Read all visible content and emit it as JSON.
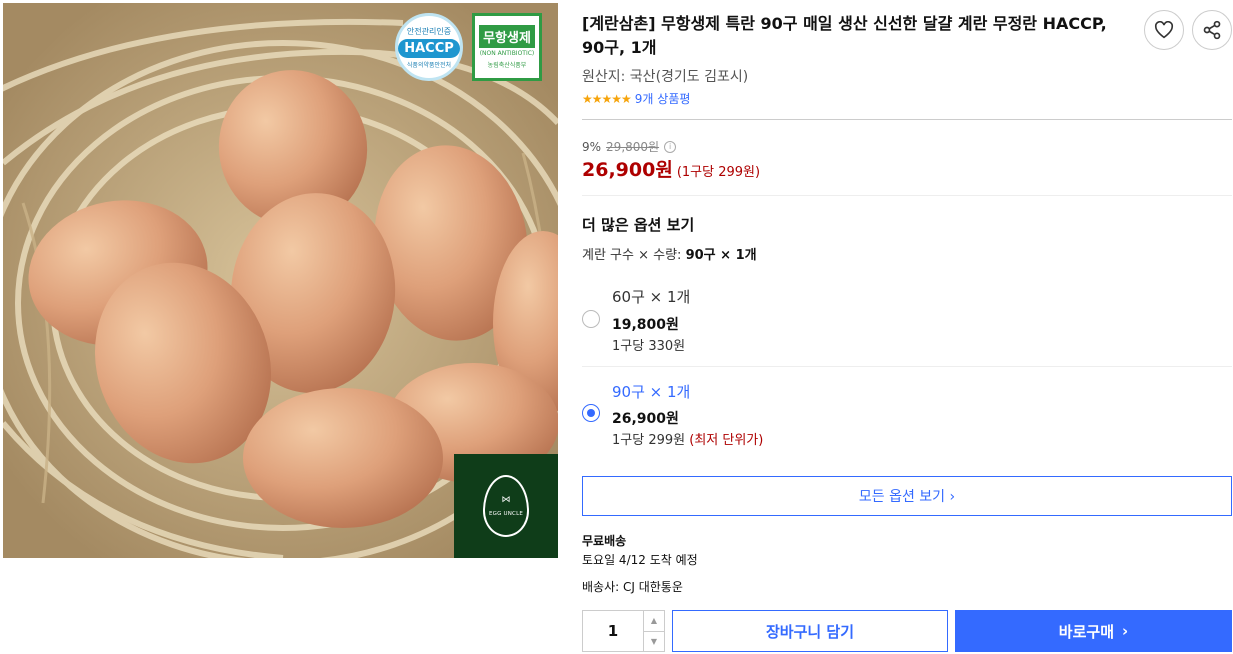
{
  "product": {
    "title": "[계란삼촌] 무항생제 특란 90구 매일 생산 신선한 달걀 계란 무정란 HACCP, 90구, 1개",
    "origin": "원산지: 국산(경기도 김포시)",
    "rating_stars": "★★★★★",
    "rating_value": 5,
    "review_count": "9개 상품평"
  },
  "image_badges": {
    "haccp_top": "안전관리인증",
    "haccp_mid": "HACCP",
    "haccp_bottom": "식품의약품안전처",
    "nonab_title": "무항생제",
    "nonab_sub": "(NON ANTIBIOTIC)",
    "nonab_org": "농림축산식품부",
    "logo_text": "EGG UNCLE"
  },
  "pricing": {
    "discount_rate": "9%",
    "original_price": "29,800원",
    "info_icon": "i",
    "sale_price": "26,900원",
    "unit_price": "(1구당 299원)"
  },
  "options": {
    "section_title": "더 많은 옵션 보기",
    "label_prefix": "계란 구수 × 수량:",
    "label_value": "90구 × 1개",
    "items": [
      {
        "name": "60구 × 1개",
        "price": "19,800원",
        "per_unit": "1구당 330원",
        "selected": false
      },
      {
        "name": "90구 × 1개",
        "price": "26,900원",
        "per_unit": "1구당 299원",
        "note": "(최저 단위가)",
        "selected": true
      }
    ],
    "view_all": "모든 옵션 보기 ›"
  },
  "shipping": {
    "free": "무료배송",
    "arrival": "토요일 4/12 도착 예정",
    "carrier": "배송사: CJ 대한통운"
  },
  "purchase": {
    "quantity": "1",
    "up_icon": "▲",
    "down_icon": "▼",
    "cart_label": "장바구니 담기",
    "buy_label": "바로구매",
    "buy_arrow": "›"
  },
  "colors": {
    "accent": "#346aff",
    "price_red": "#ae0000",
    "star": "#f6a40c"
  },
  "icons": [
    "heart-icon",
    "share-icon",
    "info-icon",
    "chevron-right-icon"
  ]
}
